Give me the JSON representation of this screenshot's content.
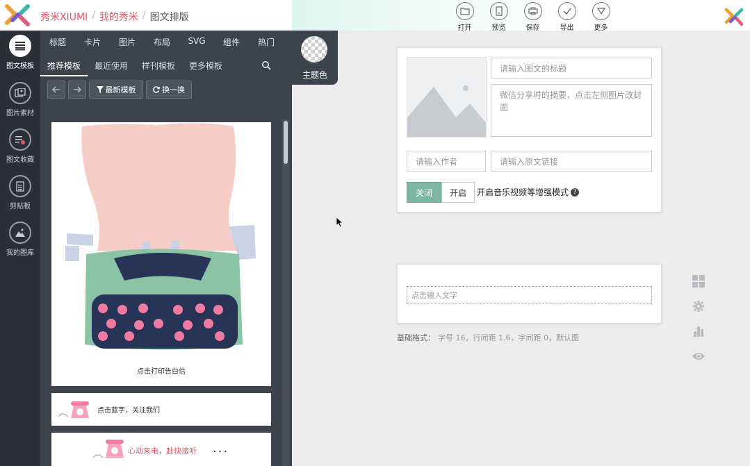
{
  "header": {
    "breadcrumb": [
      "秀米XIUMI",
      "我的秀米",
      "图文排版"
    ],
    "tools": [
      {
        "label": "打开",
        "icon": "folder-open-icon"
      },
      {
        "label": "预览",
        "icon": "preview-icon"
      },
      {
        "label": "保存",
        "icon": "save-icon"
      },
      {
        "label": "导出",
        "icon": "export-check-icon"
      },
      {
        "label": "更多",
        "icon": "more-down-icon"
      }
    ]
  },
  "rail": {
    "items": [
      {
        "label": "图文模板",
        "icon": "list-icon",
        "active": true
      },
      {
        "label": "图片素材",
        "icon": "image-material-icon"
      },
      {
        "label": "图文收藏",
        "icon": "favorite-icon"
      },
      {
        "label": "剪贴板",
        "icon": "clipboard-icon"
      },
      {
        "label": "我的图库",
        "icon": "gallery-icon"
      }
    ]
  },
  "panel": {
    "categories": [
      "标题",
      "卡片",
      "图片",
      "布局",
      "SVG",
      "组件",
      "热门"
    ],
    "subtabs": [
      "推荐模板",
      "最近使用",
      "样刊模板",
      "更多模板"
    ],
    "active_subtab": "推荐模板",
    "buttons": {
      "latest": "最新模板",
      "shuffle": "换一换"
    },
    "theme_label": "主题色",
    "templates": {
      "card1_caption": "点击打印告白信",
      "card2_text": "点击蓝字，关注我们",
      "card3_text": "心动来电，赴快接听",
      "card3_dots": "..."
    }
  },
  "editor": {
    "title_placeholder": "请输入图文的标题",
    "summary_placeholder": "微信分享时的摘要，点击左侧图片改封面",
    "author_placeholder": "请输入作者",
    "link_placeholder": "请输入原文链接",
    "toggle_off": "关闭",
    "toggle_on": "开启",
    "mode_text": "开启音乐视频等增强模式",
    "textbox_placeholder": "点击输入文字",
    "base_format_label": "基础格式：",
    "base_format_value": "字号 16，行间距 1.6，字间距 0，默认图"
  },
  "colors": {
    "brand_pink": "#e0566a",
    "panel_dark": "#3d434d",
    "rail_dark": "#2b3038",
    "toggle_green": "#7fb5a3"
  }
}
